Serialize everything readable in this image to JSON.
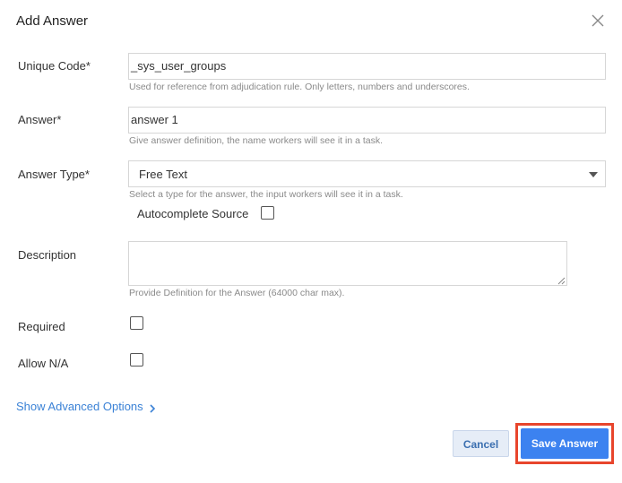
{
  "dialog": {
    "title": "Add Answer",
    "close_icon": "close-icon"
  },
  "fields": {
    "unique_code": {
      "label": "Unique Code*",
      "value": "_sys_user_groups",
      "help": "Used for reference from adjudication rule. Only letters, numbers and underscores."
    },
    "answer": {
      "label": "Answer*",
      "value": "answer 1",
      "help": "Give answer definition, the name workers will see it in a task."
    },
    "answer_type": {
      "label": "Answer Type*",
      "selected": "Free Text",
      "help": "Select a type for the answer, the input workers will see it in a task.",
      "autocomplete_label": "Autocomplete Source",
      "autocomplete_checked": false
    },
    "description": {
      "label": "Description",
      "value": "",
      "help": "Provide Definition for the Answer (64000 char max)."
    },
    "required": {
      "label": "Required",
      "checked": false
    },
    "allow_na": {
      "label": "Allow N/A",
      "checked": false
    }
  },
  "advanced": {
    "label": "Show Advanced Options",
    "icon": "chevron-right-icon"
  },
  "buttons": {
    "cancel": "Cancel",
    "save": "Save Answer"
  },
  "colors": {
    "primary": "#3c82f0",
    "highlight": "#e8452c",
    "link": "#3b82d6"
  }
}
